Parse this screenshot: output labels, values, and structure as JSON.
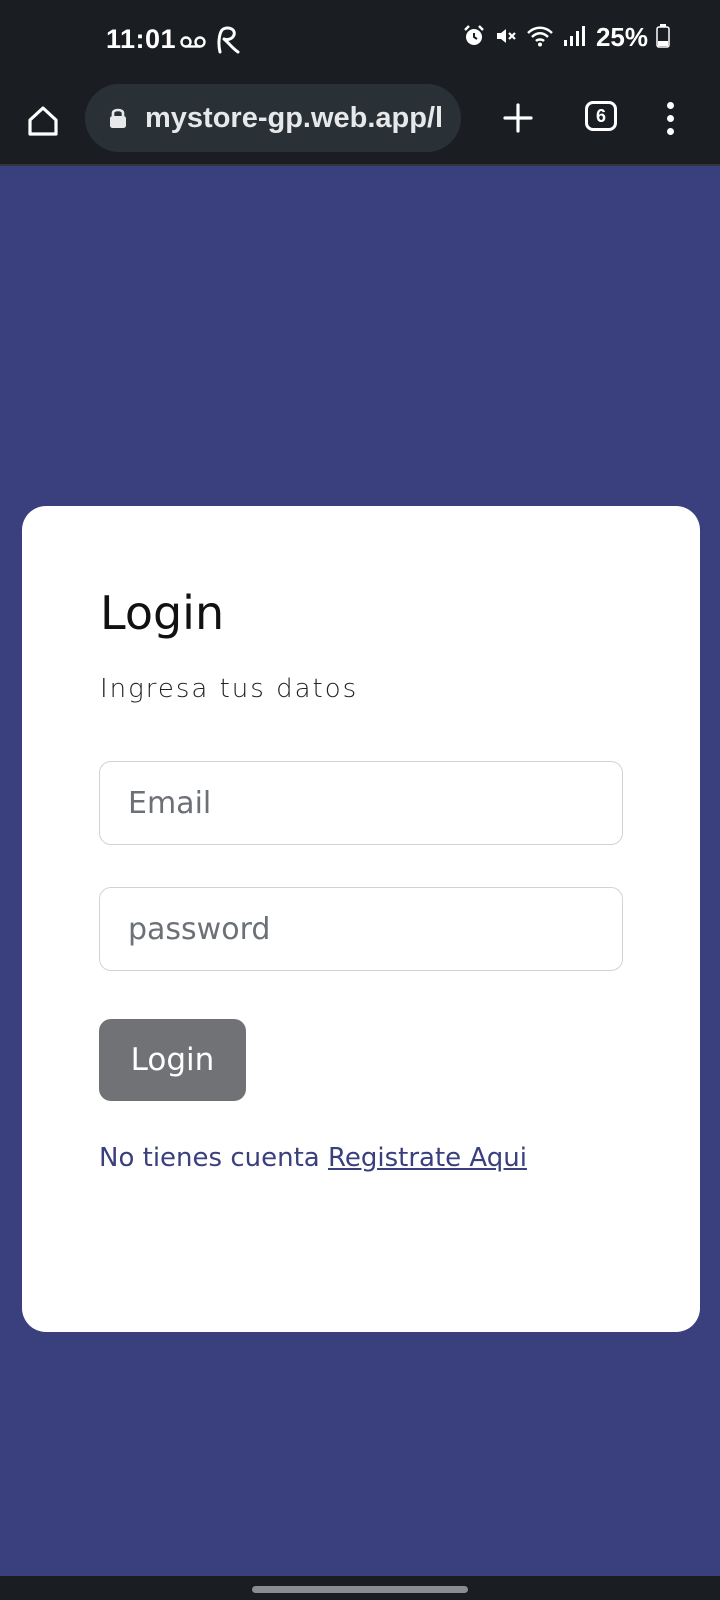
{
  "status_bar": {
    "time": "11:01",
    "battery": "25%",
    "icons": [
      "voicemail-icon",
      "r-app-icon",
      "alarm-icon",
      "mute-icon",
      "wifi-icon",
      "signal-icon",
      "battery-icon"
    ]
  },
  "browser": {
    "url": "mystore-gp.web.app/l",
    "tab_count": "6"
  },
  "login": {
    "title": "Login",
    "subtitle": "Ingresa tus datos",
    "email_placeholder": "Email",
    "password_placeholder": "password",
    "button_label": "Login",
    "register_prompt": "No tienes cuenta ",
    "register_link": "Registrate Aqui"
  },
  "colors": {
    "page_background": "#3a3f7e",
    "card_background": "#ffffff",
    "button_background": "#707276",
    "system_bar": "#1a1d21"
  }
}
